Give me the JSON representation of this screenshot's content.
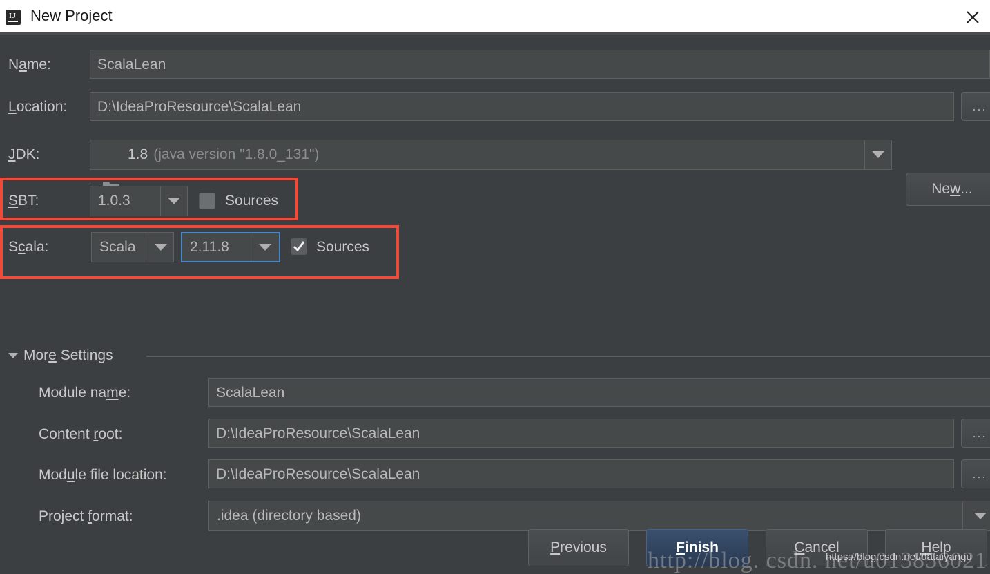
{
  "window": {
    "title": "New Project",
    "app_icon": "intellij-idea-icon",
    "close_icon": "close-icon"
  },
  "fields": {
    "name": {
      "label_pre": "N",
      "label_mn": "a",
      "label_post": "me:",
      "value": "ScalaLean"
    },
    "location": {
      "label_pre": "",
      "label_mn": "L",
      "label_post": "ocation:",
      "value": "D:\\IdeaProResource\\ScalaLean",
      "browse_label": "..."
    },
    "jdk": {
      "label_pre": "",
      "label_mn": "J",
      "label_post": "DK:",
      "value_strong": "1.8",
      "value_dim": "(java version \"1.8.0_131\")",
      "icon": "jdk-folder-icon",
      "new_button_pre": "Ne",
      "new_button_mn": "w",
      "new_button_post": "..."
    },
    "sbt": {
      "label_pre": "",
      "label_mn": "S",
      "label_post": "BT:",
      "version": "1.0.3",
      "sources_label": "Sources",
      "sources_checked": false
    },
    "scala": {
      "label_pre": "S",
      "label_mn": "c",
      "label_post": "ala:",
      "platform": "Scala",
      "version": "2.11.8",
      "sources_label": "Sources",
      "sources_checked": true
    }
  },
  "more_settings": {
    "label_pre": "Mor",
    "label_mn": "e",
    "label_post": " Settings",
    "expanded": true,
    "module_name": {
      "label_pre": "Module na",
      "label_mn": "m",
      "label_post": "e:",
      "value": "ScalaLean"
    },
    "content_root": {
      "label_pre": "Content ",
      "label_mn": "r",
      "label_post": "oot:",
      "value": "D:\\IdeaProResource\\ScalaLean",
      "browse_label": "..."
    },
    "module_file_location": {
      "label_pre": "Mod",
      "label_mn": "u",
      "label_post": "le file location:",
      "value": "D:\\IdeaProResource\\ScalaLean",
      "browse_label": "..."
    },
    "project_format": {
      "label_pre": "Project ",
      "label_mn": "f",
      "label_post": "ormat:",
      "value": ".idea (directory based)"
    }
  },
  "buttons": {
    "previous": {
      "pre": "",
      "mn": "P",
      "post": "revious"
    },
    "finish": {
      "pre": "",
      "mn": "F",
      "post": "inish"
    },
    "cancel": {
      "pre": "",
      "mn": "C",
      "post": "ancel"
    },
    "help": {
      "pre": "",
      "mn": "H",
      "post": "elp"
    }
  },
  "watermarks": {
    "big": "http://blog. csdn. net/u013856021",
    "small": "https://blog.csdn.net/dataiyangu"
  },
  "colors": {
    "panel_bg": "#3c3f41",
    "field_bg": "#45494a",
    "titlebar_bg": "#ffffff",
    "highlight_red": "#f04a3a",
    "focus_blue": "#4b86c8",
    "default_button_blue": "#39506e"
  }
}
